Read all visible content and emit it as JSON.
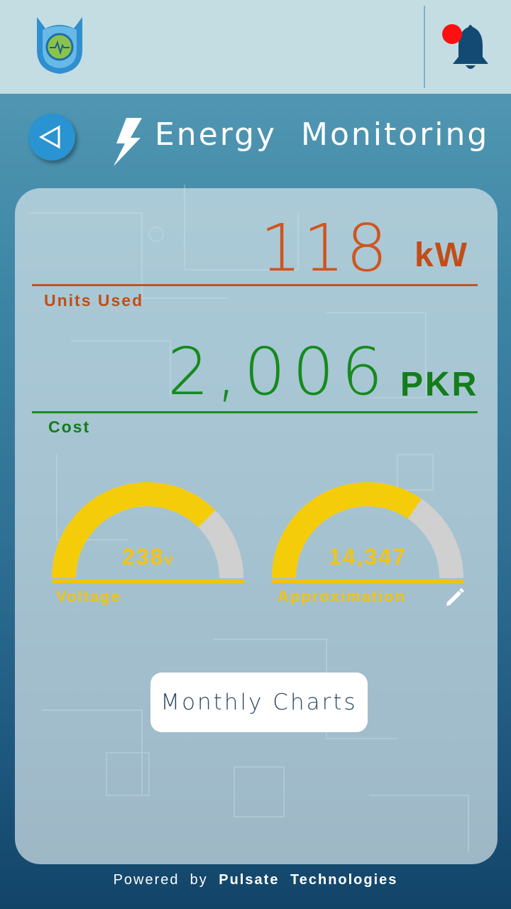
{
  "header": {
    "logo_icon": "pulse-shield-logo-icon",
    "notification_icon": "bell-icon",
    "notification_dot_color": "#ff0000"
  },
  "nav": {
    "back_icon": "back-triangle-icon",
    "title_icon": "lightning-bolt-icon",
    "title": "Energy  Monitoring"
  },
  "units": {
    "value": "118",
    "unit": "kW",
    "label": "Units Used",
    "color": "#d0551f"
  },
  "cost": {
    "value": "2,006",
    "unit": "PKR",
    "label": "Cost",
    "color": "#158a1d"
  },
  "gauges": {
    "voltage": {
      "value": "238",
      "unit": "v",
      "label": "Voltage",
      "fill_fraction": 0.75
    },
    "approximation": {
      "value": "14,347",
      "label": "Approximation",
      "fill_fraction": 0.69,
      "edit_icon": "pencil-icon"
    },
    "fill_color": "#f5cc0a",
    "track_color": "#d0d0d0"
  },
  "actions": {
    "monthly_charts_label": "Monthly Charts"
  },
  "footer": {
    "prefix": "Powered  by",
    "brand": "Pulsate Technologies"
  }
}
